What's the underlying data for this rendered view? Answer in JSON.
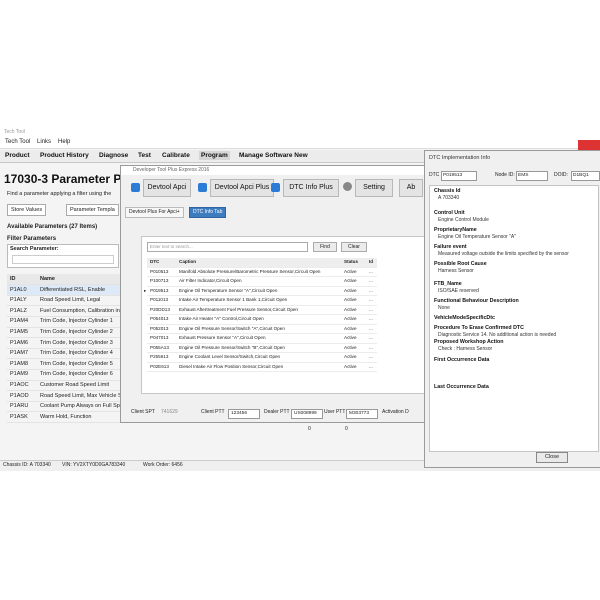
{
  "titlebar": {
    "app": "Tech Tool"
  },
  "menu": [
    "Tech Tool",
    "Links",
    "Help"
  ],
  "nav": [
    "Product",
    "Product History",
    "Diagnose",
    "Test",
    "Calibrate",
    "Program",
    "Manage Software New"
  ],
  "page": {
    "title": "17030-3 Parameter Programm",
    "find_text": "Find a parameter applying a filter using the",
    "store_values": "Store Values",
    "parameter_template": "Parameter Templa",
    "available": "Available Parameters (27 Items)",
    "filter_params": "Filter Parameters",
    "search_label": "Search Parameter:"
  },
  "params": {
    "col_id": "ID",
    "col_name": "Name",
    "rows": [
      {
        "id": "P1AL0",
        "name": "Differentiated RSL, Enable"
      },
      {
        "id": "P1ALY",
        "name": "Road Speed Limit, Legal"
      },
      {
        "id": "P1ALZ",
        "name": "Fuel Consumption, Calibration in"
      },
      {
        "id": "P1AM4",
        "name": "Trim Code, Injector Cylinder 1"
      },
      {
        "id": "P1AM5",
        "name": "Trim Code, Injector Cylinder 2"
      },
      {
        "id": "P1AM6",
        "name": "Trim Code, Injector Cylinder 3"
      },
      {
        "id": "P1AM7",
        "name": "Trim Code, Injector Cylinder 4"
      },
      {
        "id": "P1AM8",
        "name": "Trim Code, Injector Cylinder 5"
      },
      {
        "id": "P1AM9",
        "name": "Trim Code, Injector Cylinder 6"
      },
      {
        "id": "P1AOC",
        "name": "Customer Road Speed Limit"
      },
      {
        "id": "P1AOD",
        "name": "Road Speed Limit, Max Vehicle S"
      },
      {
        "id": "P1ARU",
        "name": "Coolant Pump Always on Full Sp"
      },
      {
        "id": "P1ASK",
        "name": "Warm Hold, Function"
      }
    ]
  },
  "status": {
    "chassis": "Chassis ID: A 703340",
    "vin": "VIN: YV2XTY0D0GA783340",
    "work_order": "Work Order: 6456",
    "n1": "0",
    "n2": "0"
  },
  "dev": {
    "title": "Developer Tool Plus Express 2016",
    "tabs": [
      "Devtool Apci",
      "Devtool Apci Plus",
      "DTC Info Plus",
      "Setting",
      "Ab"
    ],
    "subtabs": [
      "Devtool Plus For Apci+",
      "DTC Info Tab"
    ],
    "filter_placeholder": "Enter text to search...",
    "find": "Find",
    "clear": "Clear",
    "grid_head": {
      "dtc": "DTC",
      "caption": "Caption",
      "status": "Status",
      "id": "Id"
    },
    "rows": [
      {
        "dtc": "P010513",
        "caption": "Manifold Absolute Pressure/Barometric Pressure Sensor,Circuit Open",
        "status": "Active",
        "id": "..."
      },
      {
        "dtc": "P100713",
        "caption": "Air Filter Indicator,Circuit Open",
        "status": "Active",
        "id": "..."
      },
      {
        "dtc": "P019513",
        "caption": "Engine Oil Temperature Sensor \"A\",Circuit Open",
        "status": "Active",
        "id": "..."
      },
      {
        "dtc": "P011013",
        "caption": "Intake Air Temperature Sensor 1 Bank 1,Circuit Open",
        "status": "Active",
        "id": "..."
      },
      {
        "dtc": "P20DD13",
        "caption": "Exhaust Aftertreatment Fuel Pressure Sensor,Circuit Open",
        "status": "Active",
        "id": "..."
      },
      {
        "dtc": "P054013",
        "caption": "Intake Air Heater \"A\" Control,Circuit Open",
        "status": "Active",
        "id": "..."
      },
      {
        "dtc": "P052013",
        "caption": "Engine Oil Pressure Sensor/Switch \"A\",Circuit Open",
        "status": "Active",
        "id": "..."
      },
      {
        "dtc": "P047013",
        "caption": "Exhaust Pressure Sensor \"A\",Circuit Open",
        "status": "Active",
        "id": "..."
      },
      {
        "dtc": "P055A13",
        "caption": "Engine Oil Pressure Sensor/Switch \"B\",Circuit Open",
        "status": "Active",
        "id": "..."
      },
      {
        "dtc": "P255613",
        "caption": "Engine Coolant Level Sensor/Switch,Circuit Open",
        "status": "Active",
        "id": "..."
      },
      {
        "dtc": "P02E613",
        "caption": "Diesel Intake Air Flow Position Sensor,Circuit Open",
        "status": "Active",
        "id": "..."
      }
    ],
    "client_spt_label": "Client SPT",
    "client_spt": "741629",
    "client_ptt_label": "Client PTT",
    "client_ptt": "123456",
    "dealer_ptt_label": "Dealer PTT",
    "dealer_ptt": "US008999",
    "user_ptt_label": "User PTT",
    "user_ptt": "M303773",
    "activation": "Activation D"
  },
  "info": {
    "title": "DTC Implementation Info",
    "dtc_label": "DTC",
    "dtc": "P019513",
    "node_label": "Node ID:",
    "node": "EMS",
    "doid_label": "DOID:",
    "doid": "D1BQ1",
    "fields": [
      {
        "label": "Chassis Id",
        "value": "A 703340"
      },
      {
        "label": "Control Unit",
        "value": "Engine Control Module"
      },
      {
        "label": "ProprietaryName",
        "value": "Engine Oil Temperature Sensor \"A\""
      },
      {
        "label": "Failure event",
        "value": "Measured voltage outside the limits specified by the sensor"
      },
      {
        "label": "Possible Root Cause",
        "value": "Harness Sensor"
      },
      {
        "label": "FTB_Name",
        "value": "ISO/SAE reserved"
      },
      {
        "label": "Functional Behaviour Description",
        "value": "None"
      },
      {
        "label": "VehicleModeSpecificDtc",
        "value": ""
      },
      {
        "label": "Procedure To Erase Confirmed DTC",
        "value": "Diagnostic Service 14. No additional action is needed"
      },
      {
        "label": "Proposed Workshop Action",
        "value": "Check : Harness Sensor"
      },
      {
        "label": "First Occurrence Data",
        "value": ""
      },
      {
        "label": "Last Occurrence Data",
        "value": ""
      }
    ],
    "close": "Close"
  },
  "colors": {
    "accent": "#3e7cc0",
    "alert": "#dd3333"
  }
}
